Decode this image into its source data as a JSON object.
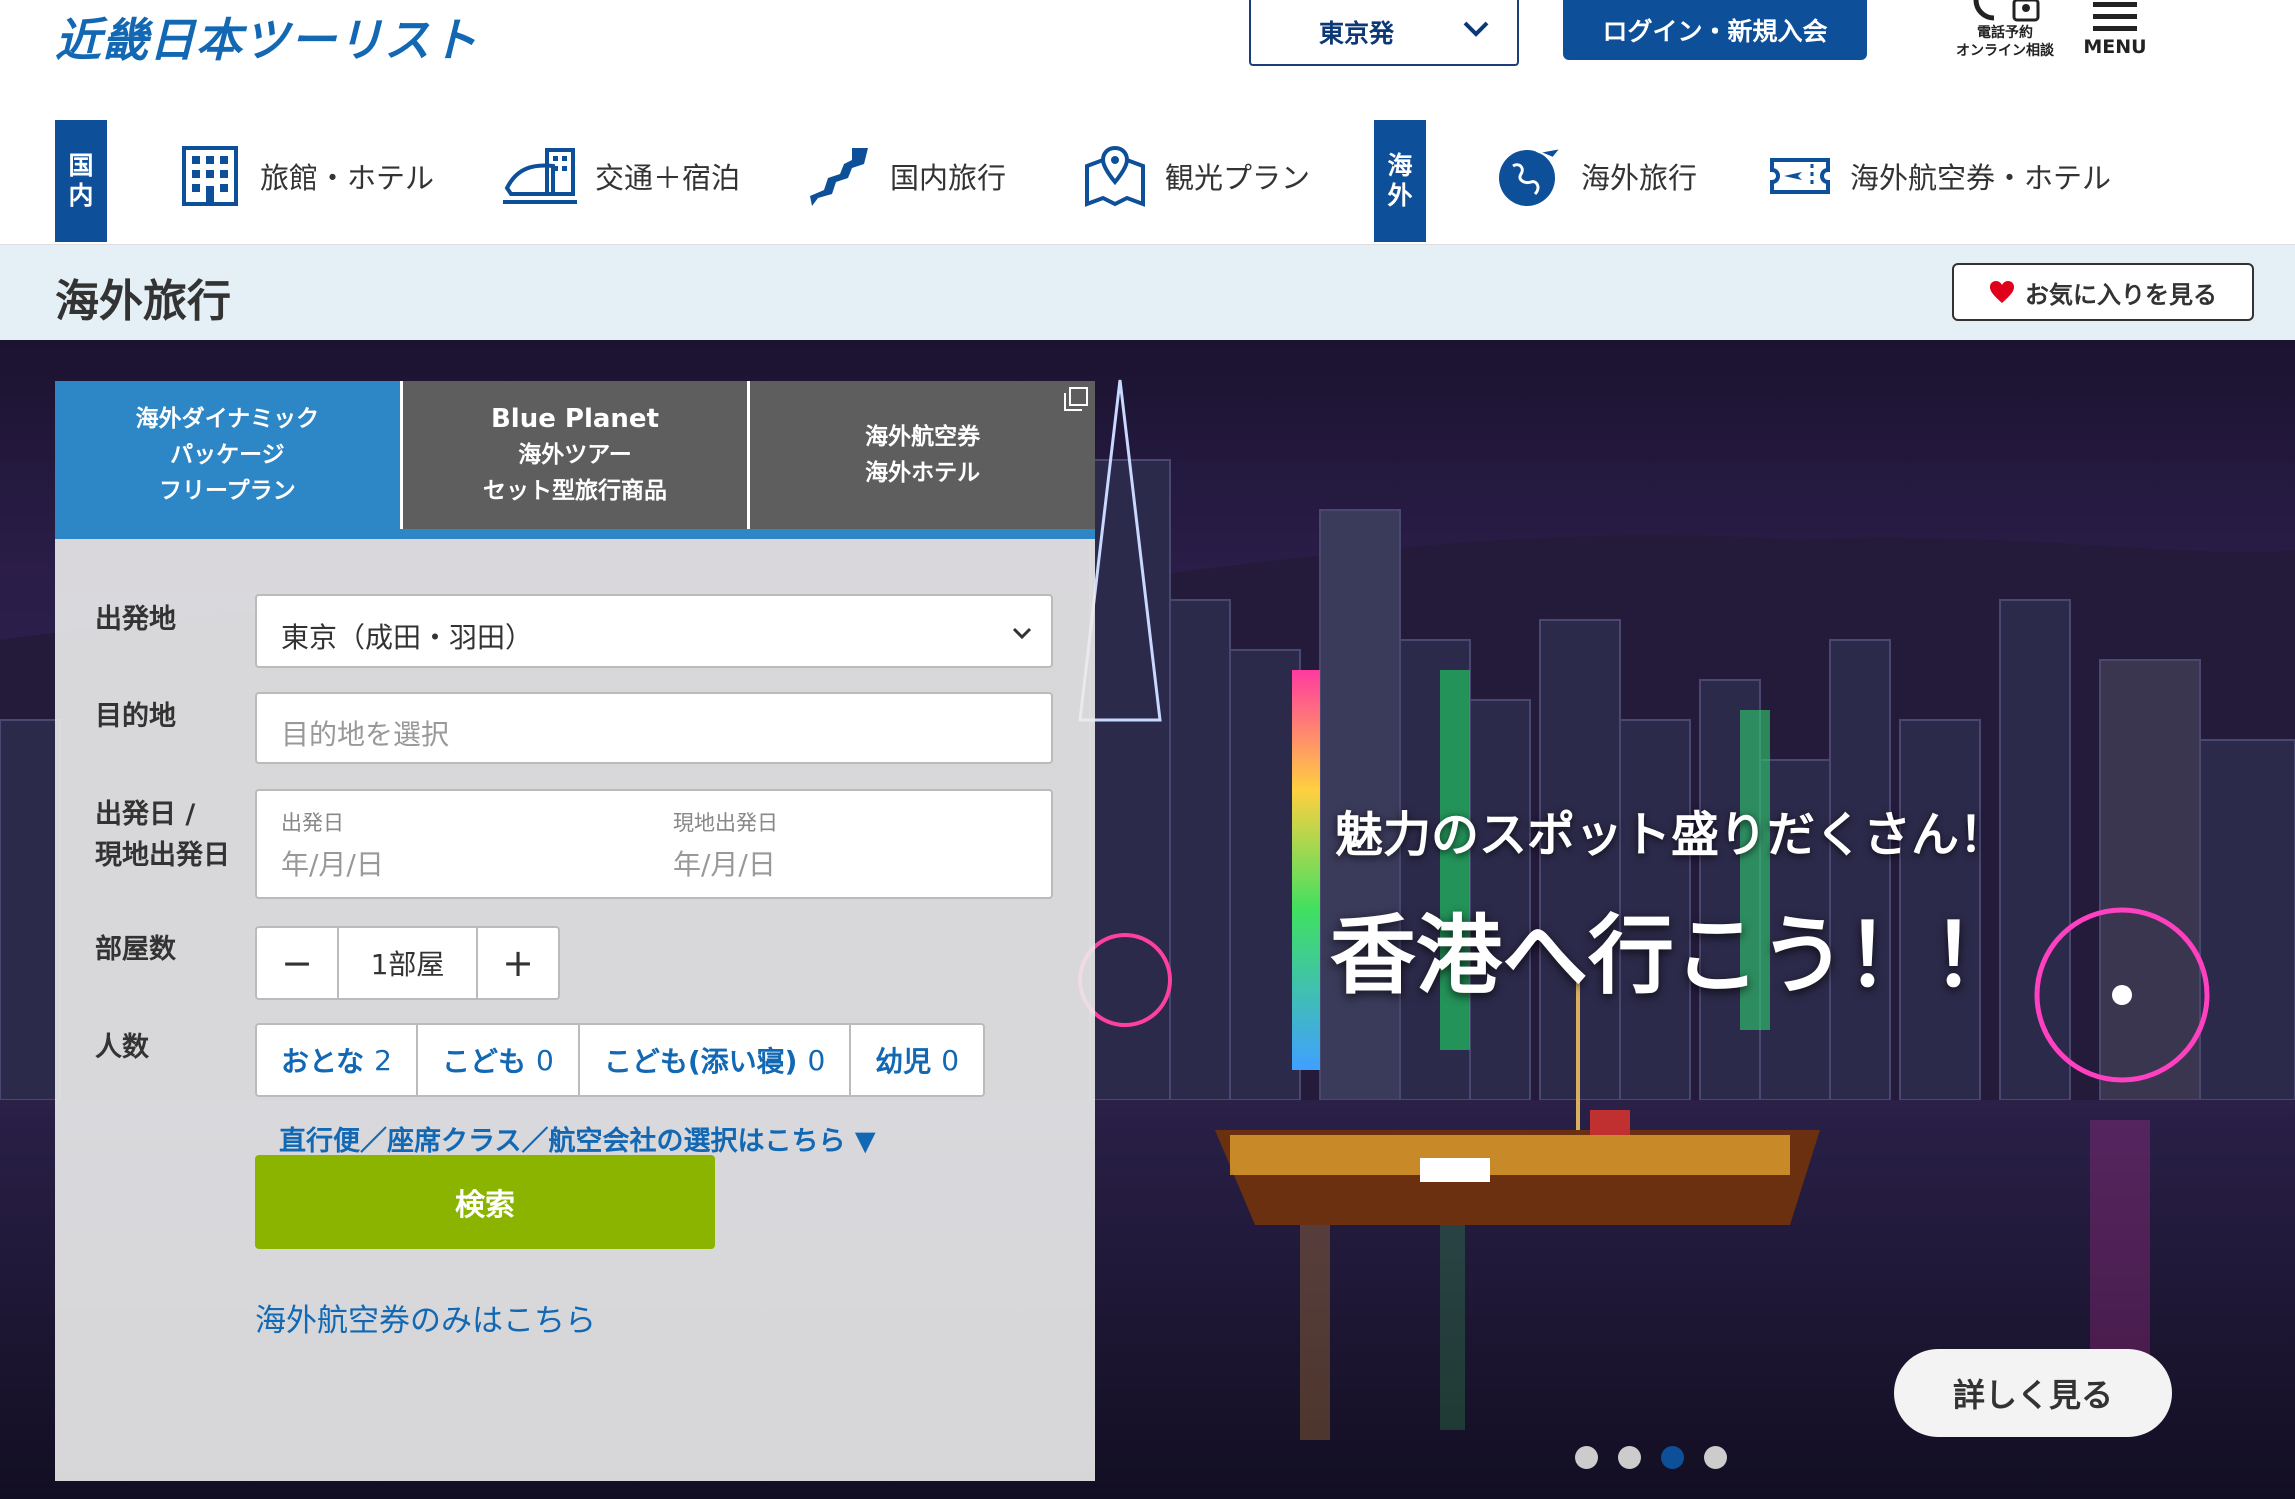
{
  "header": {
    "logo_text": "近畿日本ツーリスト",
    "origin_selected": "東京発",
    "login_label": "ログイン・新規入会",
    "phone_label_1": "電話予約",
    "phone_label_2": "オンライン相談",
    "menu_label": "MENU"
  },
  "catnav": {
    "domestic_badge": [
      "国",
      "内"
    ],
    "overseas_badge": [
      "海",
      "外"
    ],
    "items": [
      {
        "label": "旅館・ホテル",
        "icon": "hotel-icon"
      },
      {
        "label": "交通＋宿泊",
        "icon": "train-hotel-icon"
      },
      {
        "label": "国内旅行",
        "icon": "domestic-travel-icon"
      },
      {
        "label": "観光プラン",
        "icon": "map-pin-icon"
      },
      {
        "label": "海外旅行",
        "icon": "globe-plane-icon"
      },
      {
        "label": "海外航空券・ホテル",
        "icon": "ticket-icon"
      }
    ]
  },
  "page": {
    "title": "海外旅行",
    "favorites_label": "お気に入りを見る"
  },
  "search": {
    "tabs": [
      {
        "lines": [
          "海外ダイナミック",
          "パッケージ",
          "フリープラン"
        ],
        "active": true
      },
      {
        "lines": [
          "Blue Planet",
          "海外ツアー",
          "セット型旅行商品"
        ],
        "active": false
      },
      {
        "lines": [
          "海外航空券",
          "海外ホテル"
        ],
        "active": false
      }
    ],
    "departure_label": "出発地",
    "departure_value": "東京（成田・羽田）",
    "destination_label": "目的地",
    "destination_placeholder": "目的地を選択",
    "date_label_1": "出発日 /",
    "date_label_2": "現地出発日",
    "depart_date_caption": "出発日",
    "depart_date_placeholder": "年/月/日",
    "local_date_caption": "現地出発日",
    "local_date_placeholder": "年/月/日",
    "rooms_label": "部屋数",
    "rooms_minus": "−",
    "rooms_value": "1部屋",
    "rooms_plus": "+",
    "pax_label": "人数",
    "pax": [
      {
        "label": "おとな",
        "count": "2"
      },
      {
        "label": "こども",
        "count": "0"
      },
      {
        "label": "こども(添い寝)",
        "count": "0"
      },
      {
        "label": "幼児",
        "count": "0"
      }
    ],
    "advanced_link": "直行便／座席クラス／航空会社の選択はこちら ▼",
    "search_button": "検索",
    "air_only_link": "海外航空券のみはこちら"
  },
  "hero": {
    "subtitle": "魅力のスポット盛りだくさん！",
    "title": "香港へ行こう！！",
    "detail_button": "詳しく見る",
    "slides": 4,
    "active_slide": 3
  },
  "colors": {
    "brand_blue": "#0e4f9a",
    "tab_active": "#2d86c6",
    "search_green": "#8ab400",
    "link_blue": "#1268b3"
  }
}
